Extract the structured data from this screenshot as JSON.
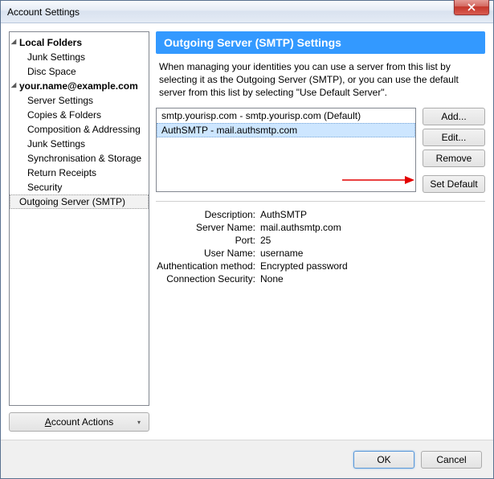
{
  "window": {
    "title": "Account Settings"
  },
  "tree": {
    "local_folders": "Local Folders",
    "junk_settings": "Junk Settings",
    "disc_space": "Disc Space",
    "account": "your.name@example.com",
    "server_settings": "Server Settings",
    "copies_folders": "Copies & Folders",
    "composition": "Composition & Addressing",
    "junk_settings2": "Junk Settings",
    "sync_storage": "Synchronisation & Storage",
    "return_receipts": "Return Receipts",
    "security": "Security",
    "outgoing_smtp": "Outgoing Server (SMTP)"
  },
  "account_actions_label": "Account Actions",
  "panel": {
    "heading": "Outgoing Server (SMTP) Settings",
    "description": "When managing your identities you can use a server from this list by selecting it as the Outgoing Server (SMTP), or you can use the default server from this list by selecting \"Use Default Server\"."
  },
  "servers": {
    "item0": "smtp.yourisp.com - smtp.yourisp.com (Default)",
    "item1": "AuthSMTP - mail.authsmtp.com"
  },
  "buttons": {
    "add": "Add...",
    "edit": "Edit...",
    "remove": "Remove",
    "set_default": "Set Default",
    "ok": "OK",
    "cancel": "Cancel"
  },
  "details": {
    "labels": {
      "description": "Description:",
      "server_name": "Server Name:",
      "port": "Port:",
      "user_name": "User Name:",
      "auth_method": "Authentication method:",
      "conn_security": "Connection Security:"
    },
    "values": {
      "description": "AuthSMTP",
      "server_name": "mail.authsmtp.com",
      "port": "25",
      "user_name": "username",
      "auth_method": "Encrypted password",
      "conn_security": "None"
    }
  }
}
